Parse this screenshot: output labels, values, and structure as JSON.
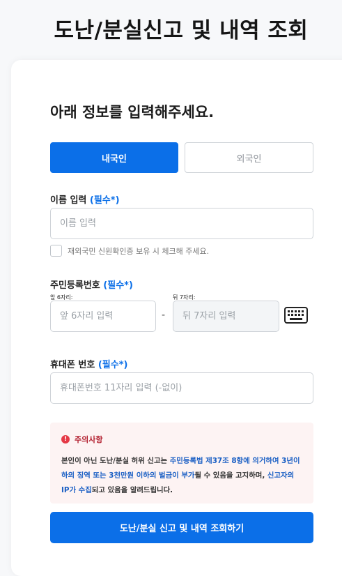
{
  "page": {
    "title": "도난/분실신고 및 내역 조회"
  },
  "form": {
    "heading": "아래 정보를 입력해주세요.",
    "tabs": [
      {
        "label": "내국인",
        "active": true
      },
      {
        "label": "외국인",
        "active": false
      }
    ],
    "required_tag": "(필수*)",
    "name": {
      "label": "이름 입력",
      "placeholder": "이름 입력",
      "value": ""
    },
    "checkbox": {
      "label": "재외국민 신원확인증 보유 시 체크해 주세요.",
      "checked": false
    },
    "rrn": {
      "label": "주민등록번호",
      "front_sublabel": "앞 6자리:",
      "front_placeholder": "앞 6자리 입력",
      "separator": "-",
      "back_sublabel": "뒤 7자리:",
      "back_placeholder": "뒤 7자리 입력"
    },
    "phone": {
      "label": "휴대폰 번호",
      "placeholder": "휴대폰번호 11자리 입력 (-없이)",
      "value": ""
    },
    "notice": {
      "title": "주의사항",
      "body": [
        {
          "text": "본인이 아닌 도난/분실 허위 신고는 ",
          "highlight": false
        },
        {
          "text": "주민등록법 제37조 8항에 의거하여 3년이하의 징역 또는 3천만원 이하의 벌금이 부가",
          "highlight": true
        },
        {
          "text": "될 수 있음을 고지하며, ",
          "highlight": false
        },
        {
          "text": "신고자의 IP가 수집",
          "highlight": true
        },
        {
          "text": "되고 있음을 알려드립니다.",
          "highlight": false
        }
      ]
    },
    "submit_label": "도난/분실 신고 및 내역 조회하기"
  },
  "colors": {
    "accent": "#0b6fe8",
    "notice_bg": "#fdf3f3",
    "notice_title": "#b21e2e",
    "alert_icon": "#e53946",
    "highlight_text": "#1a5fc4"
  },
  "icons": {
    "alert": "alert-circle-icon",
    "keyboard": "keyboard-icon"
  }
}
